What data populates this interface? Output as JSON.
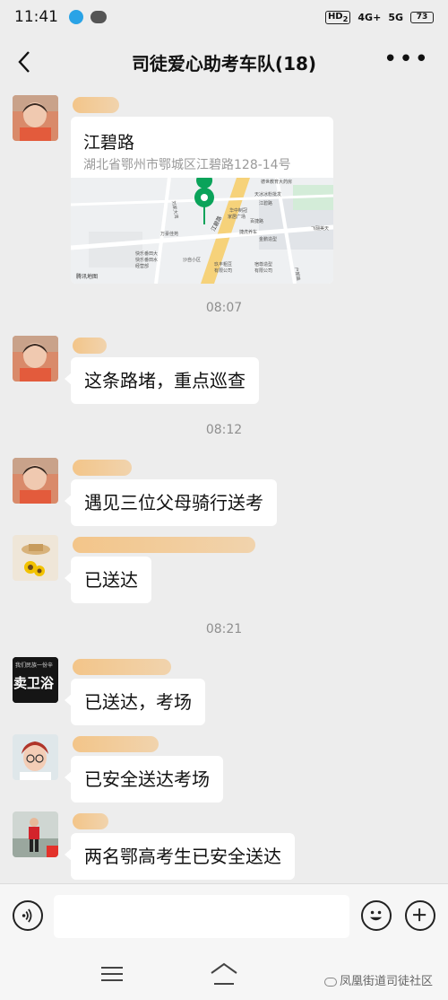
{
  "status_bar": {
    "time": "11:41",
    "hd": "HD",
    "hd_sub": "2",
    "net1": "4G+",
    "net2": "5G",
    "battery": "73"
  },
  "header": {
    "title": "司徒爱心助考车队(18)"
  },
  "messages": [
    {
      "type": "location",
      "location_title": "江碧路",
      "location_address": "湖北省鄂州市鄂城区江碧路128-14号",
      "map_labels": [
        "德世教育大药房",
        "天冰冰粉批发",
        "华中制冠",
        "家居广场",
        "百捷路",
        "江碧路",
        "万豪佳苑",
        "捷虎养车",
        "江碧路",
        "金鹏造型",
        "刘家大湾",
        "快乐番田大",
        "快乐番田水",
        "经营部",
        "沙自小区",
        "玖丰粗豆",
        "有限公司",
        "宿尊造型",
        "有限公司",
        "飞翮美天",
        "户部路",
        "腾讯地图"
      ]
    },
    {
      "type": "time",
      "text": "08:07"
    },
    {
      "type": "text",
      "text": "这条路堵，重点巡查"
    },
    {
      "type": "time",
      "text": "08:12"
    },
    {
      "type": "text",
      "text": "遇见三位父母骑行送考"
    },
    {
      "type": "text",
      "text": "已送达"
    },
    {
      "type": "time",
      "text": "08:21"
    },
    {
      "type": "text",
      "text": "已送达，考场"
    },
    {
      "type": "text",
      "text": "已安全送达考场"
    },
    {
      "type": "text",
      "text": "两名鄂高考生已安全送达"
    }
  ],
  "sender_names": {
    "m1": "江",
    "m2": "",
    "m3": "江远夕",
    "m4": "浩刻",
    "m5": "卫",
    "m6": "创",
    "m7": "宋军"
  },
  "avatar_texts": {
    "m5_top": "我们民族一份辛",
    "m5_big": "卖卫浴"
  },
  "watermark": "凤凰街道司徒社区",
  "colors": {
    "background": "#ededed",
    "bubble": "#ffffff",
    "timestamp": "#8f8f8f",
    "map_pin": "#0aa35a"
  }
}
